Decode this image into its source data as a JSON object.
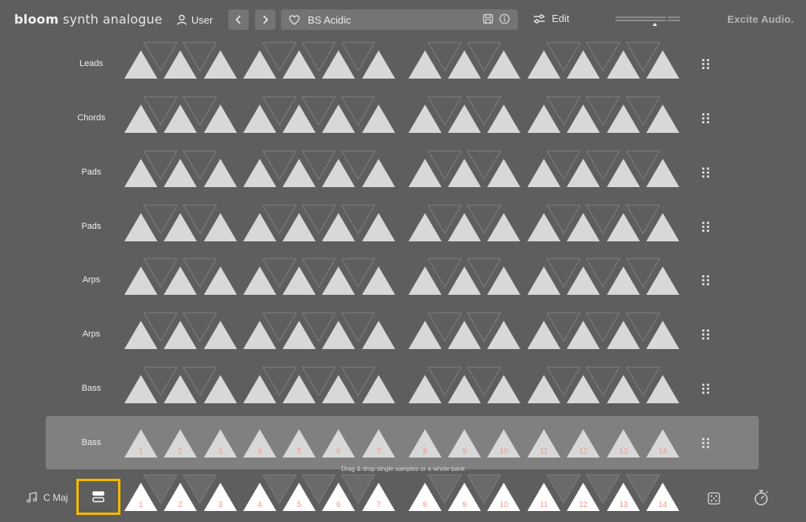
{
  "app": {
    "name_bold": "bloom",
    "name_rest": " synth analogue",
    "brand": "Excite Audio."
  },
  "header": {
    "user_label": "User",
    "preset_name": "BS Acidic",
    "edit_label": "Edit"
  },
  "rows": [
    {
      "label": "Leads"
    },
    {
      "label": "Chords"
    },
    {
      "label": "Pads"
    },
    {
      "label": "Pads"
    },
    {
      "label": "Arps"
    },
    {
      "label": "Arps"
    },
    {
      "label": "Bass"
    },
    {
      "label": "Bass",
      "selected": true,
      "show_numbers": true
    }
  ],
  "keyboard_numbers": [
    "1",
    "2",
    "3",
    "4",
    "5",
    "6",
    "7",
    "8",
    "9",
    "10",
    "11",
    "12",
    "13",
    "14"
  ],
  "footer": {
    "key_label": "C Maj",
    "drop_hint": "Drag & drop single samples or a whole bank"
  },
  "colors": {
    "background": "#5e5e5e",
    "triangle_fill": "#d8d8d8",
    "triangle_outline": "#7e7e7e",
    "number_color": "#f29a8a",
    "selection_border": "#f5b800",
    "highlight_panel": "#808080"
  },
  "icons": {
    "user": "user-icon",
    "prev": "chevron-left-icon",
    "next": "chevron-right-icon",
    "favorite": "heart-icon",
    "save": "save-icon",
    "info": "info-icon",
    "edit": "sliders-icon",
    "drag": "drag-handle-icon",
    "key": "music-note-icon",
    "bank": "bank-icon",
    "randomize": "dice-icon",
    "timer": "stopwatch-icon"
  }
}
